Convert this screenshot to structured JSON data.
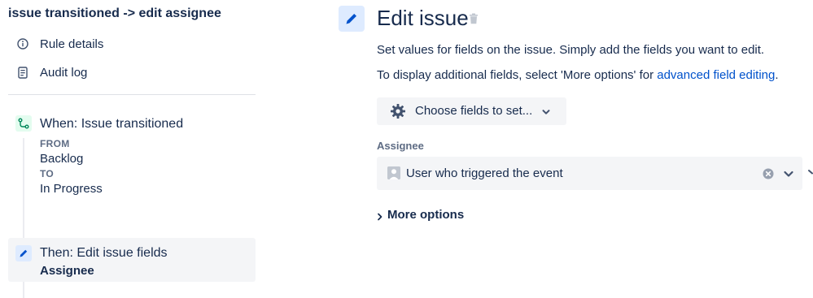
{
  "rule": {
    "title": "issue transitioned -> edit assignee"
  },
  "sidebar": {
    "items": [
      {
        "label": "Rule details",
        "icon": "info-icon"
      },
      {
        "label": "Audit log",
        "icon": "document-icon"
      }
    ]
  },
  "trigger": {
    "title": "When: Issue transitioned",
    "from_label": "FROM",
    "from_value": "Backlog",
    "to_label": "TO",
    "to_value": "In Progress",
    "icon": "branch-icon"
  },
  "action": {
    "title": "Then: Edit issue fields",
    "subtitle": "Assignee",
    "icon": "pencil-icon"
  },
  "panel": {
    "title": "Edit issue",
    "description": "Set values for fields on the issue. Simply add the fields you want to edit.",
    "hint_prefix": "To display additional fields, select 'More options' for",
    "hint_link": "advanced field editing",
    "hint_suffix": ".",
    "choose_fields_label": "Choose fields to set...",
    "field_label": "Assignee",
    "field_value": "User who triggered the event",
    "more_options_label": "More options"
  },
  "colors": {
    "link": "#0052cc",
    "text": "#172b4d",
    "muted": "#5e6c84",
    "trigger_bg": "#e3fcef",
    "trigger_fg": "#00875a",
    "action_bg": "#deebff",
    "action_fg": "#0052cc"
  }
}
